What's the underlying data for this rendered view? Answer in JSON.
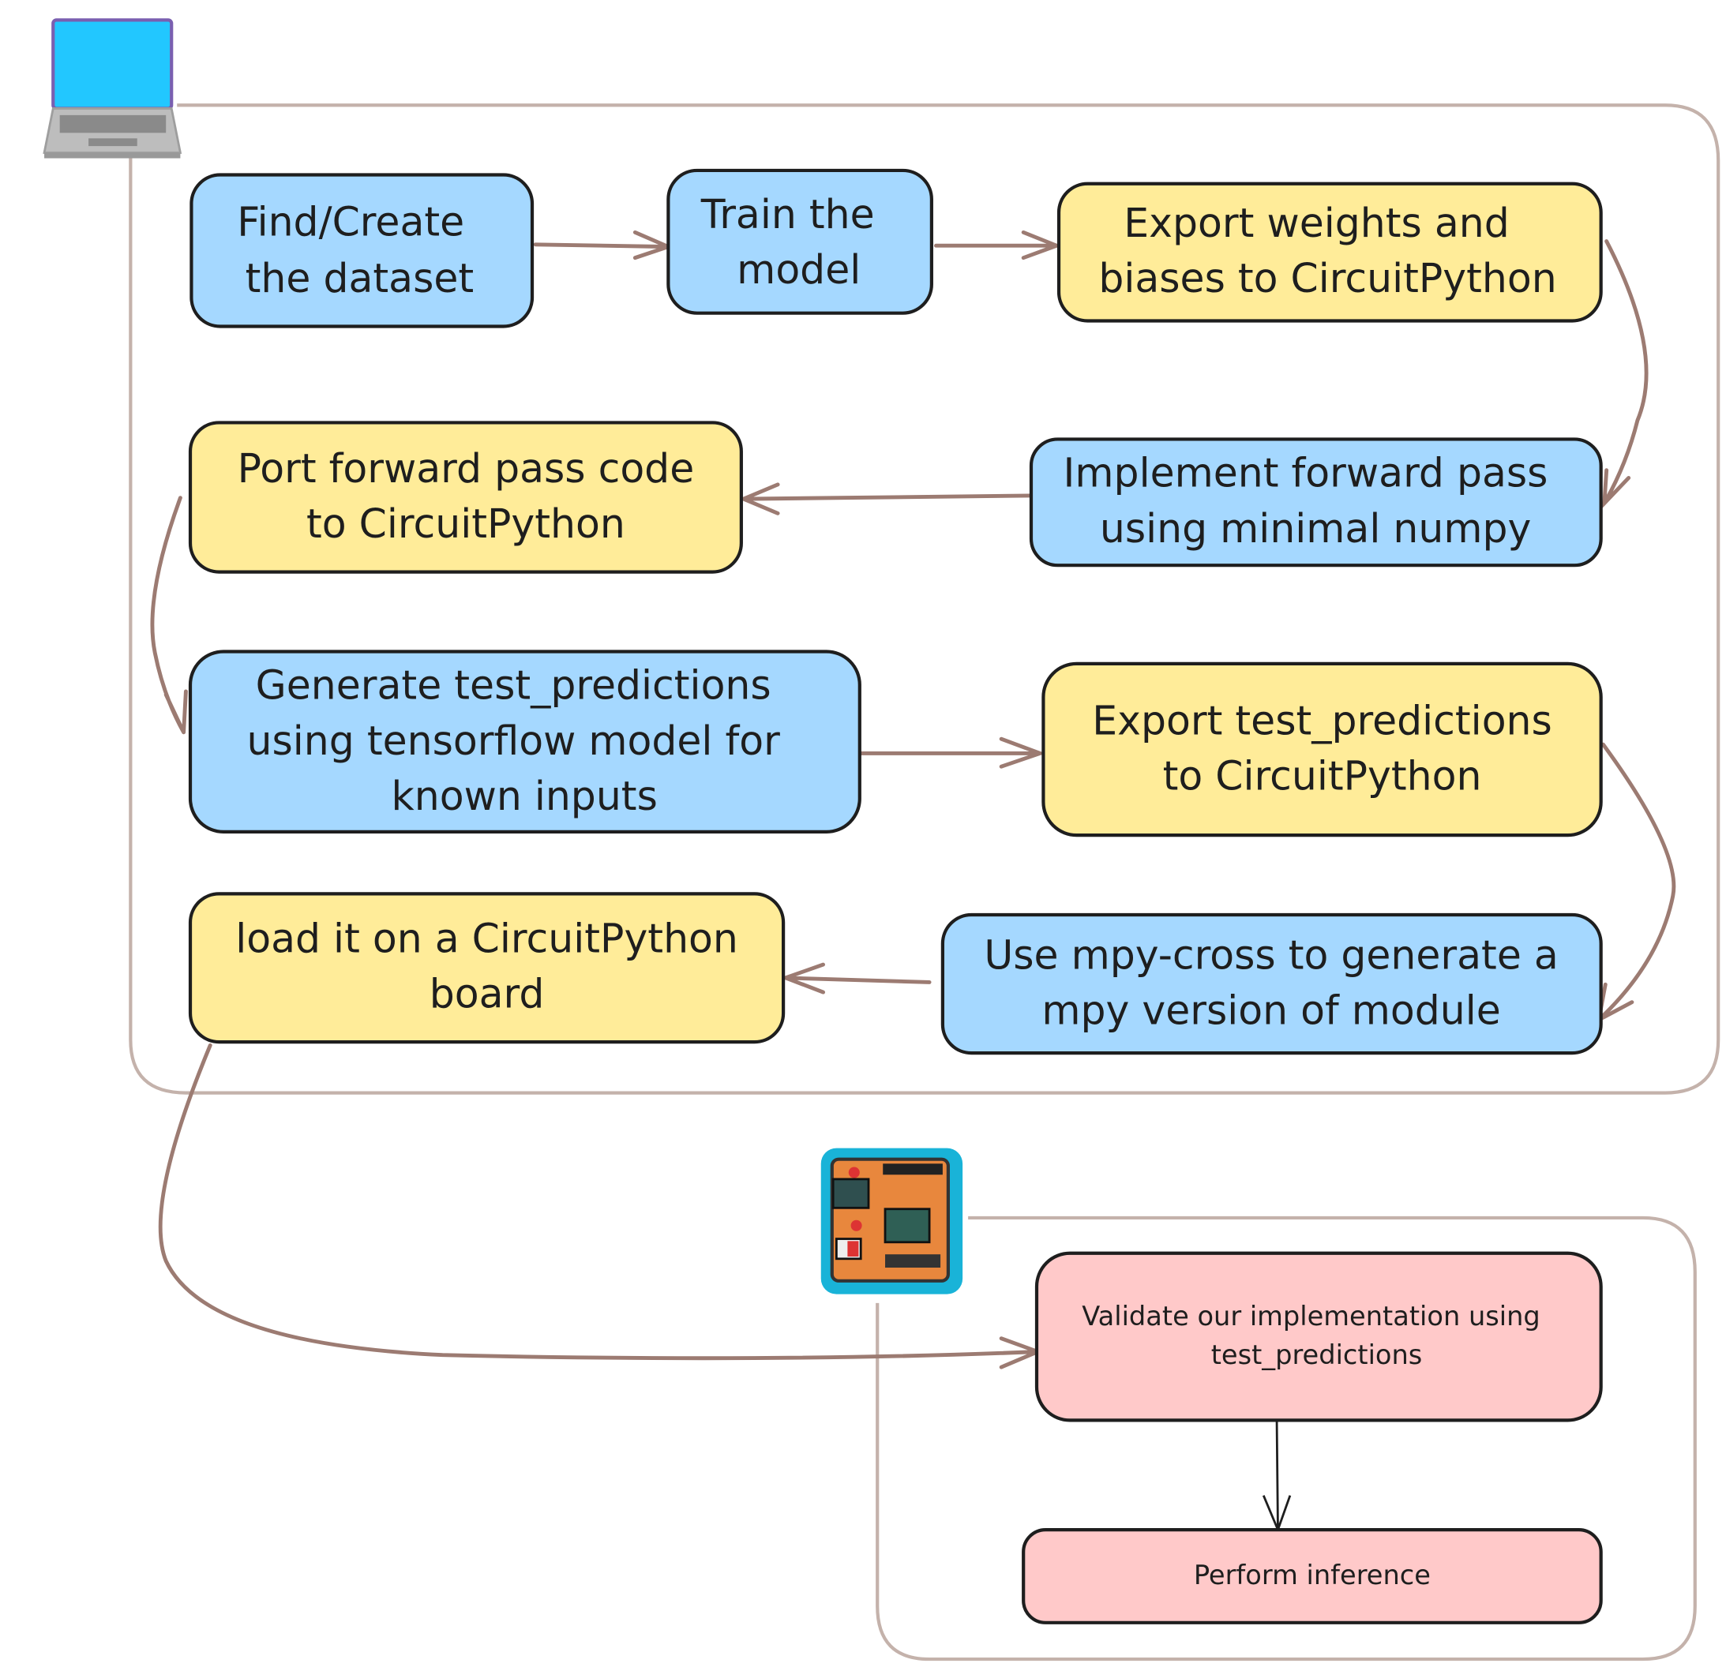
{
  "colors": {
    "blue": "#a5d8ff",
    "yellow": "#ffec99",
    "pink": "#ffc9c9",
    "arrow": "#9c7b72",
    "frame": "#c4b2ab"
  },
  "icons": {
    "computer": "laptop-icon",
    "device": "circuit-board-icon"
  },
  "nodes": {
    "find_dataset": [
      "Find/Create",
      "the dataset"
    ],
    "train_model": [
      "Train the",
      "model"
    ],
    "export_weights": [
      "Export weights and",
      "biases to CircuitPython"
    ],
    "implement_forward": [
      "Implement forward pass",
      "using minimal numpy"
    ],
    "port_forward": [
      "Port forward pass code",
      "to CircuitPython"
    ],
    "generate_predictions": [
      "Generate test_predictions",
      "using tensorflow model for",
      "known inputs"
    ],
    "export_predictions": [
      "Export test_predictions",
      "to CircuitPython"
    ],
    "mpy_cross": [
      "Use mpy-cross to generate a",
      "mpy version of module"
    ],
    "load_board": [
      "load it on a CircuitPython",
      "board"
    ],
    "validate": [
      "Validate our implementation using",
      "test_predictions"
    ],
    "inference": [
      "Perform inference"
    ]
  }
}
